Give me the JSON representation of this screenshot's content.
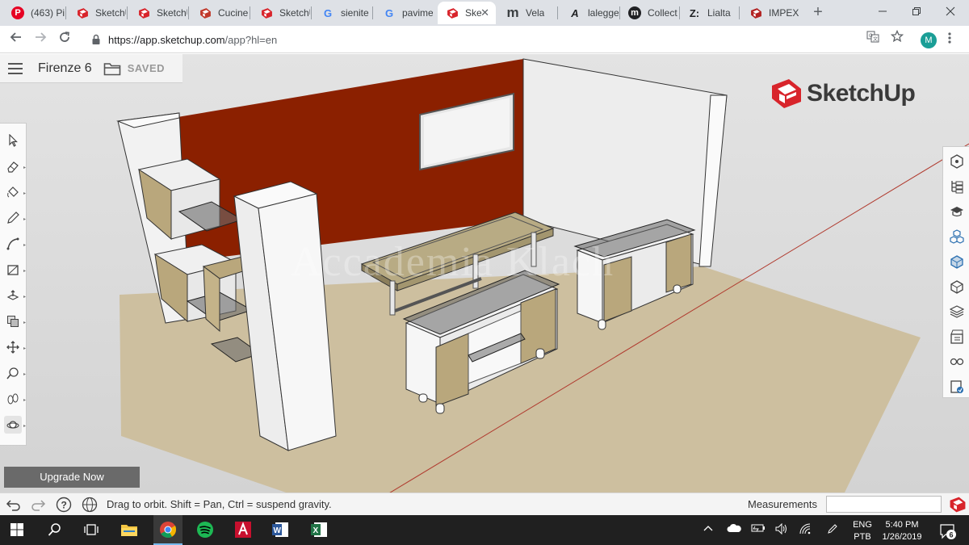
{
  "browser": {
    "tabs": [
      {
        "title": "(463) Pi",
        "icon": "pinterest-icon",
        "color": "#e60023",
        "glyph": "P"
      },
      {
        "title": "SketchU",
        "icon": "sketchup-icon",
        "color": "#d8242b",
        "glyph": ""
      },
      {
        "title": "SketchU",
        "icon": "sketchup-icon",
        "color": "#d8242b",
        "glyph": ""
      },
      {
        "title": "Cucine",
        "icon": "cucine-icon",
        "color": "#c0392b",
        "glyph": ""
      },
      {
        "title": "SketchU",
        "icon": "sketchup-icon",
        "color": "#d8242b",
        "glyph": ""
      },
      {
        "title": "sienite",
        "icon": "google-icon",
        "color": "#4285f4",
        "glyph": "G"
      },
      {
        "title": "pavime",
        "icon": "google-icon",
        "color": "#4285f4",
        "glyph": "G"
      },
      {
        "title": "Ske",
        "icon": "sketchup-icon",
        "color": "#d8242b",
        "glyph": "",
        "active": true
      },
      {
        "title": "Vela",
        "icon": "m-icon",
        "color": "#3c4043",
        "glyph": "m"
      },
      {
        "title": "lalegge",
        "icon": "a-icon",
        "color": "#202124",
        "glyph": "A"
      },
      {
        "title": "Collect",
        "icon": "m-circle-icon",
        "color": "#202124",
        "glyph": "m"
      },
      {
        "title": "Lialta",
        "icon": "z-icon",
        "color": "#202124",
        "glyph": "Z:"
      },
      {
        "title": "IMPEX",
        "icon": "impex-icon",
        "color": "#b22222",
        "glyph": ""
      }
    ],
    "url_main": "https://app.sketchup.com",
    "url_rest": "/app?hl=en",
    "avatar_letter": "M"
  },
  "app": {
    "file_name": "Firenze 6",
    "saved_label": "SAVED",
    "brand_name": "SketchUp",
    "watermark": "Accademia Klach",
    "upgrade_label": "Upgrade Now",
    "status_message": "Drag to orbit. Shift = Pan, Ctrl = suspend gravity.",
    "measurements_label": "Measurements",
    "measurements_value": "",
    "left_tools": [
      "select-tool-icon",
      "eraser-tool-icon",
      "paint-bucket-icon",
      "pencil-tool-icon",
      "arc-tool-icon",
      "rectangle-tool-icon",
      "push-pull-icon",
      "offset-tool-icon",
      "move-tool-icon",
      "tape-measure-icon",
      "walk-tool-icon",
      "orbit-tool-icon"
    ],
    "right_tools": [
      "entity-info-icon",
      "outliner-icon",
      "instructor-icon",
      "components-icon",
      "materials-icon",
      "styles-icon",
      "layers-icon",
      "scenes-icon",
      "display-icon",
      "3d-warehouse-icon"
    ],
    "colors": {
      "accent_red": "#d8242b",
      "wall_red": "#8b2000",
      "floor": "#cfc0a0"
    }
  },
  "taskbar": {
    "language": "ENG",
    "layout": "PTB",
    "time": "5:40 PM",
    "date": "1/26/2019",
    "notifications": "6"
  }
}
